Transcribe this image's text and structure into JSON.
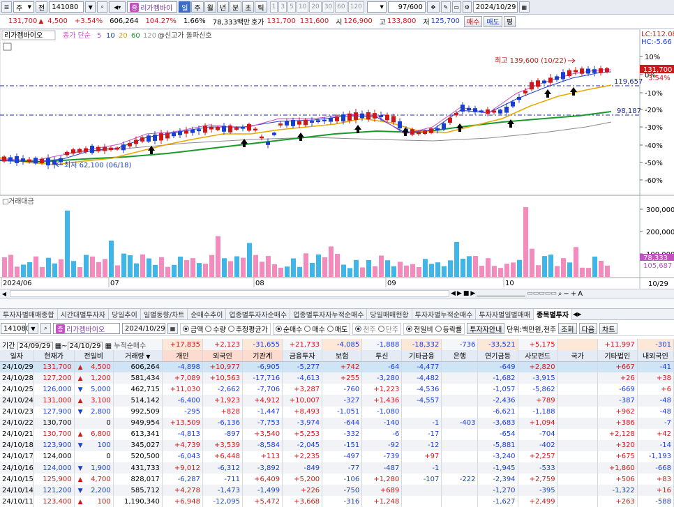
{
  "toolbar": {
    "market": "주",
    "code": "141080",
    "period_select": "전",
    "stock_name": "리가켐바이",
    "periods": [
      "일",
      "주",
      "월",
      "년",
      "분",
      "초",
      "틱"
    ],
    "intervals": [
      "1",
      "3",
      "5",
      "10",
      "20",
      "30",
      "60",
      "120"
    ],
    "count": "97/600",
    "date": "2024/10/29"
  },
  "quote": {
    "price": "131,700",
    "change": "4,500",
    "change_pct": "+3.54%",
    "volume": "606,264",
    "vol_ratio": "104.27%",
    "turnover": "1.66%",
    "amount": "78,333백만",
    "ask_label": "호가",
    "ask": "131,700",
    "bid": "131,600",
    "open_label": "시",
    "open": "126,900",
    "high_label": "고",
    "high": "133,800",
    "low_label": "저",
    "low": "125,700",
    "buy_label": "매수",
    "sell_label": "매도",
    "eval_label": "평"
  },
  "chart": {
    "legend_name": "리가켐바이오",
    "ma_label": "종가 단순",
    "ma_periods": [
      "5",
      "10",
      "20",
      "60",
      "120"
    ],
    "signal_label": "@신고가 돌파신호",
    "lc_label": "LC:112.08",
    "hc_label": "HC:-5.66",
    "high_note": "최고 139,600 (10/22)",
    "low_note": "최저 62,100 (06/18)",
    "hline_upper": "119,657",
    "hline_lower": "98,187",
    "price_tag": "131,700",
    "price_pct": "3.54%",
    "pct_ticks": [
      "10%",
      "-10%",
      "-20%",
      "-30%",
      "-40%",
      "-50%",
      "-60%"
    ],
    "pct_zero": "0%",
    "volume_title": "거래대금",
    "vol_ticks": [
      "300,000",
      "200,000",
      "100,000"
    ],
    "vol_tag1": "78,333",
    "vol_tag2": "105,687",
    "months": [
      "2024/06",
      "07",
      "08",
      "09",
      "10"
    ],
    "last_date": "10/29"
  },
  "tabs": [
    "투자자별매매종합",
    "시간대별투자자",
    "당일추이",
    "일별동향/차트",
    "순매수추이",
    "업종별투자자순매수",
    "업종별투자자누적순매수",
    "당일매매현황",
    "투자자별누적순매수",
    "투자자별일별매매",
    "종목별투자"
  ],
  "controls": {
    "code": "141080",
    "name": "리가켐바이오",
    "date": "2024/10/29",
    "r1": [
      "금액",
      "수량",
      "추정평균가"
    ],
    "r2": [
      "순매수",
      "매수",
      "매도"
    ],
    "r3": [
      "천주",
      "단주"
    ],
    "r4": [
      "전일비",
      "등락률"
    ],
    "guide_btn": "투자자안내",
    "unit": "단위:백만원,천주",
    "query_btn": "조회",
    "next_btn": "다음",
    "chart_btn": "차트"
  },
  "period": {
    "label": "기간",
    "from": "24/09/29",
    "to": "24/10/29",
    "cum_label": "누적순매수",
    "sums": [
      "+17,835",
      "+2,123",
      "-31,655",
      "+21,733",
      "-4,085",
      "-1,888",
      "-18,332",
      "-736",
      "-33,521",
      "+5,175",
      "",
      "+11,997",
      "-301"
    ]
  },
  "table": {
    "headers": [
      "일자",
      "현재가",
      "전일비",
      "거래량",
      "개인",
      "외국인",
      "기관계",
      "금융투자",
      "보험",
      "투신",
      "기타금융",
      "은행",
      "연기금등",
      "사모펀드",
      "국가",
      "기타법인",
      "내외국인"
    ],
    "rows": [
      [
        "24/10/29",
        "131,700",
        "u",
        "4,500",
        "606,264",
        "-4,898",
        "+10,977",
        "-6,905",
        "-5,277",
        "+742",
        "-64",
        "-4,477",
        "",
        "-649",
        "+2,820",
        "",
        "+667",
        "-41"
      ],
      [
        "24/10/28",
        "127,200",
        "u",
        "1,200",
        "581,434",
        "+7,089",
        "+10,563",
        "-17,716",
        "-4,613",
        "+255",
        "-3,280",
        "-4,482",
        "",
        "-1,682",
        "-3,915",
        "",
        "+26",
        "+38"
      ],
      [
        "24/10/25",
        "126,000",
        "d",
        "5,000",
        "462,715",
        "+11,030",
        "-2,662",
        "-7,706",
        "+3,287",
        "-760",
        "+1,223",
        "-4,536",
        "",
        "-1,057",
        "-5,862",
        "",
        "-669",
        "+6"
      ],
      [
        "24/10/24",
        "131,000",
        "u",
        "3,100",
        "514,142",
        "-6,400",
        "+1,923",
        "+4,912",
        "+10,007",
        "-327",
        "+1,436",
        "-4,557",
        "",
        "-2,436",
        "+789",
        "",
        "-387",
        "-48"
      ],
      [
        "24/10/23",
        "127,900",
        "d",
        "2,800",
        "992,509",
        "-295",
        "+828",
        "-1,447",
        "+8,493",
        "-1,051",
        "-1,080",
        "",
        "",
        "-6,621",
        "-1,188",
        "",
        "+962",
        "-48"
      ],
      [
        "24/10/22",
        "130,700",
        "",
        "0",
        "949,954",
        "+13,509",
        "-6,136",
        "-7,753",
        "-3,974",
        "-644",
        "-140",
        "-1",
        "-403",
        "-3,683",
        "+1,094",
        "",
        "+386",
        "-7"
      ],
      [
        "24/10/21",
        "130,700",
        "u",
        "6,800",
        "613,341",
        "-4,813",
        "-897",
        "+3,540",
        "+5,253",
        "-332",
        "-6",
        "-17",
        "",
        "-654",
        "-704",
        "",
        "+2,128",
        "+42"
      ],
      [
        "24/10/18",
        "123,900",
        "d",
        "100",
        "345,027",
        "+4,739",
        "+3,539",
        "-8,584",
        "-2,045",
        "-151",
        "-92",
        "-12",
        "",
        "-5,881",
        "-402",
        "",
        "+320",
        "-14"
      ],
      [
        "24/10/17",
        "124,000",
        "",
        "0",
        "520,500",
        "-6,043",
        "+6,448",
        "+113",
        "+2,235",
        "-497",
        "-739",
        "+97",
        "",
        "-3,240",
        "+2,257",
        "",
        "+675",
        "-1,193"
      ],
      [
        "24/10/16",
        "124,000",
        "d",
        "1,900",
        "431,733",
        "+9,012",
        "-6,312",
        "-3,892",
        "-849",
        "-77",
        "-487",
        "-1",
        "",
        "-1,945",
        "-533",
        "",
        "+1,860",
        "-668"
      ],
      [
        "24/10/15",
        "125,900",
        "u",
        "4,700",
        "828,017",
        "-6,287",
        "-711",
        "+6,409",
        "+5,200",
        "-106",
        "+1,280",
        "-107",
        "-222",
        "-2,394",
        "+2,759",
        "",
        "+506",
        "+83"
      ],
      [
        "24/10/14",
        "121,200",
        "d",
        "2,200",
        "585,712",
        "+4,278",
        "-1,473",
        "-1,499",
        "+226",
        "-750",
        "+689",
        "",
        "",
        "-1,270",
        "-395",
        "",
        "-1,322",
        "+16"
      ],
      [
        "24/10/11",
        "123,400",
        "u",
        "100",
        "1,190,340",
        "+6,948",
        "-12,095",
        "+5,472",
        "+3,668",
        "-316",
        "+1,248",
        "",
        "",
        "-1,627",
        "+2,499",
        "",
        "+263",
        "-588"
      ]
    ]
  }
}
